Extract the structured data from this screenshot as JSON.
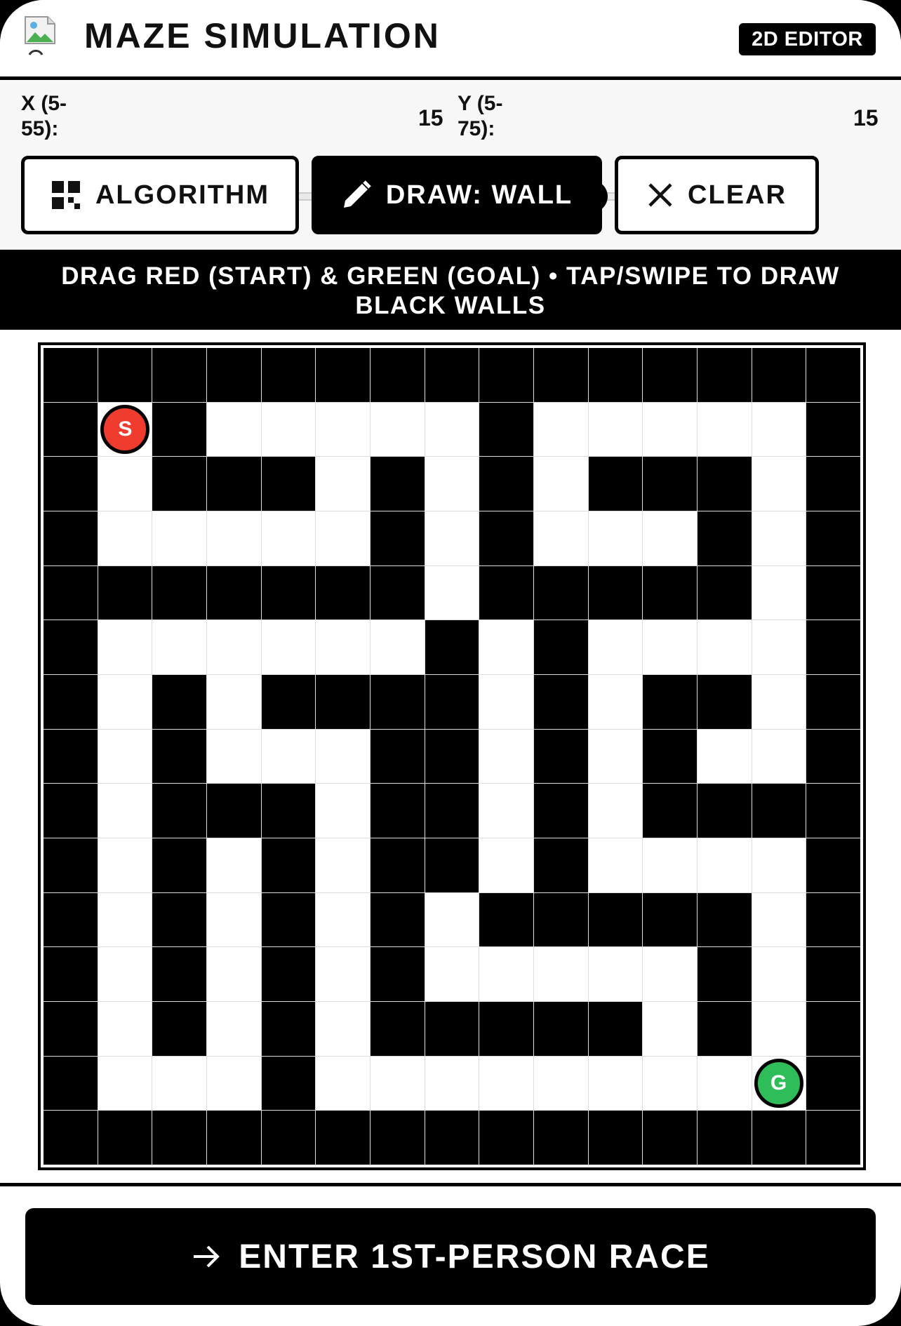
{
  "header": {
    "title": "MAZE SIMULATION",
    "badge": "2D EDITOR",
    "logo_icon": "broken-image-icon"
  },
  "controls": {
    "x_slider": {
      "label": "X (5-\n55):",
      "min": 5,
      "max": 55,
      "value": 15,
      "value_text": "15"
    },
    "y_slider": {
      "label": "Y (5-\n75):",
      "min": 5,
      "max": 75,
      "value": 15,
      "value_text": "15"
    },
    "buttons": {
      "algorithm": {
        "label": "ALGORITHM",
        "icon": "grid-icon"
      },
      "draw": {
        "label": "DRAW: WALL",
        "icon": "pencil-icon"
      },
      "clear": {
        "label": "CLEAR",
        "icon": "close-icon"
      }
    }
  },
  "banner": {
    "text": "DRAG RED (START) & GREEN (GOAL) • TAP/SWIPE TO DRAW BLACK WALLS"
  },
  "maze": {
    "cols": 15,
    "rows": 15,
    "grid": [
      "###############",
      "#S#.....#.....#",
      "#.###.#.#.###.#",
      "#.....#.#...#.#",
      "#######.#####.#",
      "#......#.#....#",
      "#.#.####.#.##.#",
      "#.#...##.#.#..#",
      "#.###.##.#.####",
      "#.#.#.##.#....#",
      "#.#.#.#.#####.#",
      "#.#.#.#.....#.#",
      "#.#.#.#####.#.#",
      "#...#........G#",
      "###############"
    ],
    "start": {
      "label": "S",
      "row": 1,
      "col": 1,
      "color": "#f03c2e"
    },
    "goal": {
      "label": "G",
      "row": 13,
      "col": 13,
      "color": "#2ebd59"
    }
  },
  "footer": {
    "race_label": "ENTER 1ST-PERSON RACE",
    "race_icon": "arrow-right-icon"
  }
}
